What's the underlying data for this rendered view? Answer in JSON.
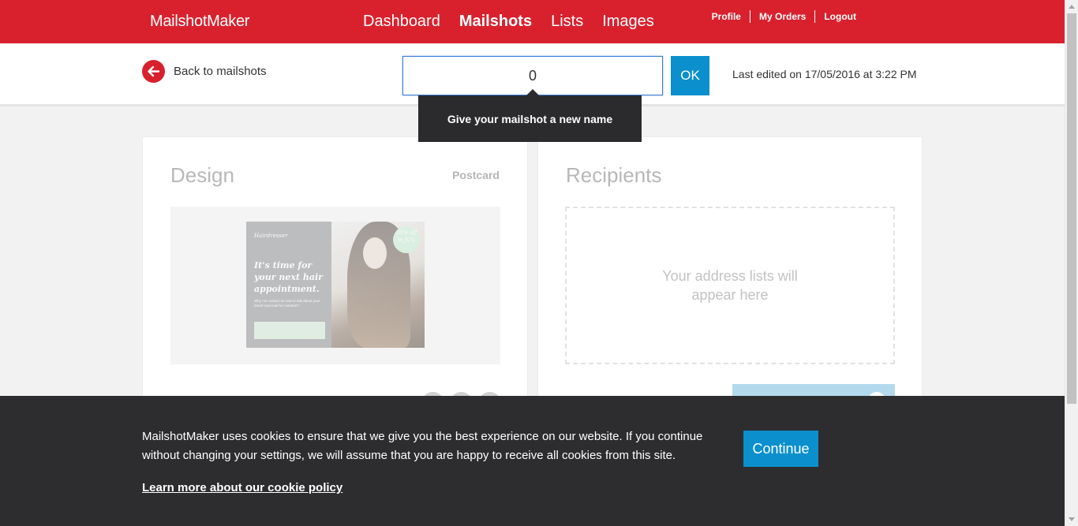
{
  "header": {
    "brand": "MailshotMaker",
    "nav": [
      "Dashboard",
      "Mailshots",
      "Lists",
      "Images"
    ],
    "active_nav": "Mailshots",
    "user_links": [
      "Profile",
      "My Orders",
      "Logout"
    ]
  },
  "subheader": {
    "back_label": "Back to mailshots",
    "name_value": "0",
    "ok_label": "OK",
    "last_edited": "Last edited on 17/05/2016 at 3:22 PM",
    "tooltip": "Give your mailshot a new name"
  },
  "design": {
    "title": "Design",
    "format": "Postcard",
    "postcard": {
      "logo": "Hairdresser",
      "headline": "It's time for your next hair appointment.",
      "body": "Why not contact us now to talk about your brand new look for summer?",
      "badge": "20% off in July"
    }
  },
  "recipients": {
    "title": "Recipients",
    "empty_text": "Your address lists will appear here"
  },
  "cookie": {
    "text": "MailshotMaker uses cookies to ensure that we give you the best experience on our website. If you continue without changing your settings, we will assume that you are happy to receive all cookies from this site.",
    "link": "Learn more about our cookie policy",
    "button": "Continue"
  },
  "colors": {
    "brand_red": "#d9212e",
    "accent_blue": "#0b8fcd",
    "banner_dark": "#2d2d30"
  }
}
